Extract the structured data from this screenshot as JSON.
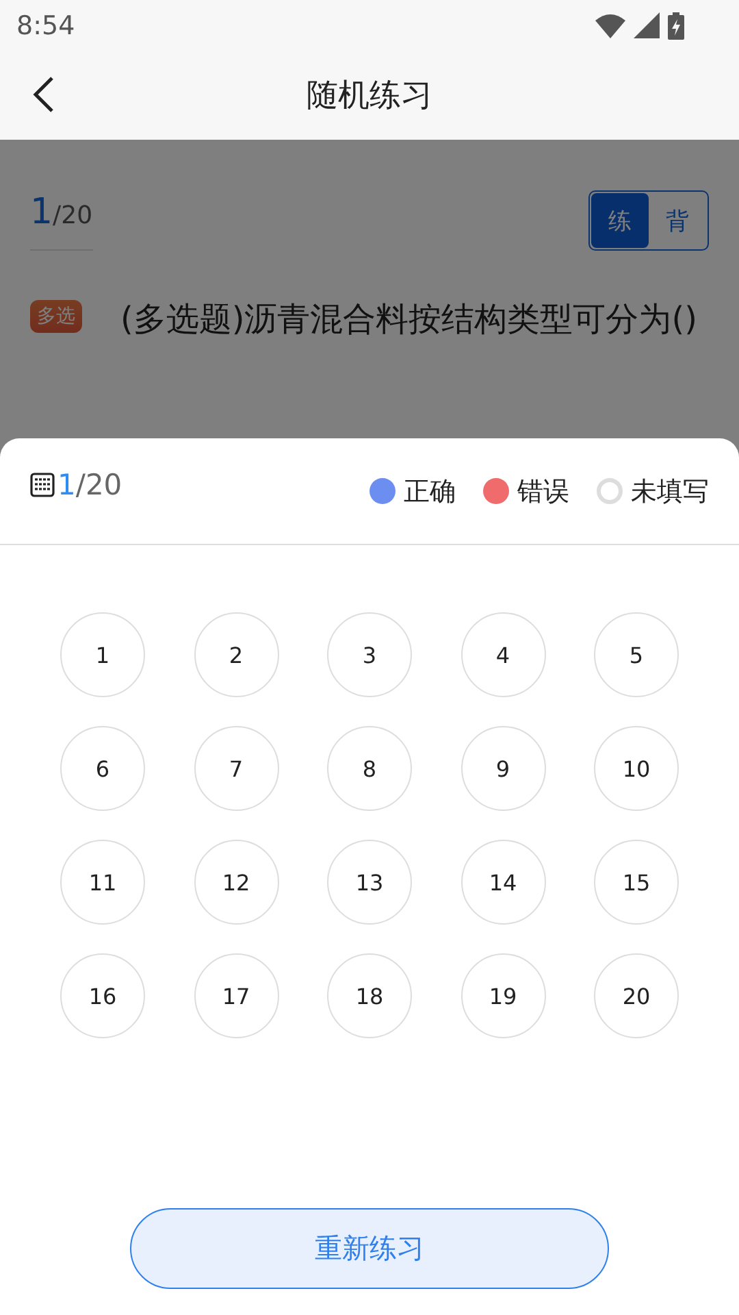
{
  "status_bar": {
    "time": "8:54"
  },
  "header": {
    "title": "随机练习"
  },
  "question": {
    "current": "1",
    "total": "/20",
    "mode_tabs": [
      {
        "label": "练",
        "selected": true
      },
      {
        "label": "背",
        "selected": false
      }
    ],
    "type_badge": "多选",
    "text": "(多选题)沥青混合料按结构类型可分为()"
  },
  "answer_sheet": {
    "current": "1",
    "total": "/20",
    "legend": [
      {
        "label": "正确",
        "kind": "filled",
        "color": "#6b8ef0"
      },
      {
        "label": "错误",
        "kind": "filled",
        "color": "#f06b6b"
      },
      {
        "label": "未填写",
        "kind": "outline",
        "color": "#dddddd"
      }
    ],
    "numbers": [
      {
        "label": "1"
      },
      {
        "label": "2"
      },
      {
        "label": "3"
      },
      {
        "label": "4"
      },
      {
        "label": "5"
      },
      {
        "label": "6"
      },
      {
        "label": "7"
      },
      {
        "label": "8"
      },
      {
        "label": "9"
      },
      {
        "label": "10"
      },
      {
        "label": "11"
      },
      {
        "label": "12"
      },
      {
        "label": "13"
      },
      {
        "label": "14"
      },
      {
        "label": "15"
      },
      {
        "label": "16"
      },
      {
        "label": "17"
      },
      {
        "label": "18"
      },
      {
        "label": "19"
      },
      {
        "label": "20"
      }
    ],
    "button": "重新练习"
  }
}
